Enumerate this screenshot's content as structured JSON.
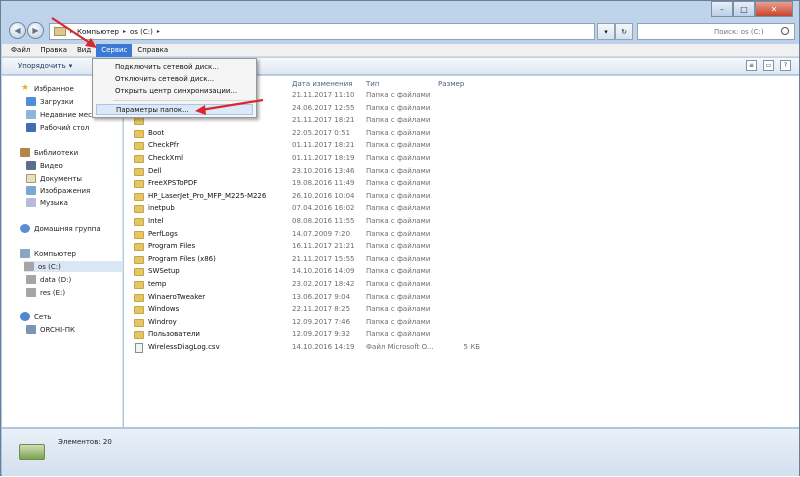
{
  "window": {
    "path": [
      "Компьютер",
      "os (C:)"
    ],
    "search_placeholder": "Поиск: os (C:)",
    "controls": [
      "–",
      "□",
      "✕"
    ]
  },
  "menubar": {
    "items": [
      {
        "label": "Файл",
        "active": false
      },
      {
        "label": "Правка",
        "active": false
      },
      {
        "label": "Вид",
        "active": false
      },
      {
        "label": "Сервис",
        "active": true
      },
      {
        "label": "Справка",
        "active": false
      }
    ]
  },
  "toolbar": {
    "organize": "Упорядочить",
    "organize_arrow": "▾"
  },
  "dropdown": {
    "items": [
      "Подключить сетевой диск...",
      "Отключить сетевой диск...",
      "Открыть центр синхронизации...",
      "Параметры папок..."
    ]
  },
  "navpane": {
    "favorites": {
      "label": "Избранное",
      "items": [
        "Загрузки",
        "Недавние места",
        "Рабочий стол"
      ]
    },
    "libraries": {
      "label": "Библиотеки",
      "items": [
        "Видео",
        "Документы",
        "Изображения",
        "Музыка"
      ]
    },
    "homegroup": {
      "label": "Домашняя группа"
    },
    "computer": {
      "label": "Компьютер",
      "items": [
        "os (C:)",
        "data (D:)",
        "res (E:)"
      ]
    },
    "network": {
      "label": "Сеть",
      "items": [
        "ORCHI-ПК"
      ]
    }
  },
  "columns": {
    "date": "Дата изменения",
    "type": "Тип",
    "size": "Размер"
  },
  "files": [
    {
      "name": "",
      "date": "21.11.2017 11:10",
      "type": "Папка с файлами",
      "size": "",
      "kind": "folder"
    },
    {
      "name": "",
      "date": "24.06.2017 12:55",
      "type": "Папка с файлами",
      "size": "",
      "kind": "folder"
    },
    {
      "name": "",
      "date": "21.11.2017 18:21",
      "type": "Папка с файлами",
      "size": "",
      "kind": "folder"
    },
    {
      "name": "Boot",
      "date": "22.05.2017 0:51",
      "type": "Папка с файлами",
      "size": "",
      "kind": "folder"
    },
    {
      "name": "CheckPfr",
      "date": "01.11.2017 18:21",
      "type": "Папка с файлами",
      "size": "",
      "kind": "folder"
    },
    {
      "name": "CheckXml",
      "date": "01.11.2017 18:19",
      "type": "Папка с файлами",
      "size": "",
      "kind": "folder"
    },
    {
      "name": "Dell",
      "date": "23.10.2016 13:46",
      "type": "Папка с файлами",
      "size": "",
      "kind": "folder"
    },
    {
      "name": "FreeXPSToPDF",
      "date": "19.08.2016 11:49",
      "type": "Папка с файлами",
      "size": "",
      "kind": "folder"
    },
    {
      "name": "HP_LaserJet_Pro_MFP_M225-M226",
      "date": "26.10.2016 10:04",
      "type": "Папка с файлами",
      "size": "",
      "kind": "folder"
    },
    {
      "name": "inetpub",
      "date": "07.04.2016 16:02",
      "type": "Папка с файлами",
      "size": "",
      "kind": "folder"
    },
    {
      "name": "Intel",
      "date": "08.08.2016 11:55",
      "type": "Папка с файлами",
      "size": "",
      "kind": "folder"
    },
    {
      "name": "PerfLogs",
      "date": "14.07.2009 7:20",
      "type": "Папка с файлами",
      "size": "",
      "kind": "folder"
    },
    {
      "name": "Program Files",
      "date": "16.11.2017 21:21",
      "type": "Папка с файлами",
      "size": "",
      "kind": "folder"
    },
    {
      "name": "Program Files (x86)",
      "date": "21.11.2017 15:55",
      "type": "Папка с файлами",
      "size": "",
      "kind": "folder"
    },
    {
      "name": "SWSetup",
      "date": "14.10.2016 14:09",
      "type": "Папка с файлами",
      "size": "",
      "kind": "folder"
    },
    {
      "name": "temp",
      "date": "23.02.2017 18:42",
      "type": "Папка с файлами",
      "size": "",
      "kind": "folder"
    },
    {
      "name": "WinaeroTweaker",
      "date": "13.06.2017 9:04",
      "type": "Папка с файлами",
      "size": "",
      "kind": "folder"
    },
    {
      "name": "Windows",
      "date": "22.11.2017 8:25",
      "type": "Папка с файлами",
      "size": "",
      "kind": "folder"
    },
    {
      "name": "Windroy",
      "date": "12.09.2017 7:46",
      "type": "Папка с файлами",
      "size": "",
      "kind": "folder"
    },
    {
      "name": "Пользователи",
      "date": "12.09.2017 9:32",
      "type": "Папка с файлами",
      "size": "",
      "kind": "folder"
    },
    {
      "name": "WirelessDiagLog.csv",
      "date": "14.10.2016 14:19",
      "type": "Файл Microsoft O...",
      "size": "5 КБ",
      "kind": "file"
    }
  ],
  "status": {
    "count": "Элементов: 20"
  },
  "colors": {
    "menu_active": "#3b7ad4",
    "annotation_arrow": "#d9272d",
    "folder": "#e5c664"
  }
}
